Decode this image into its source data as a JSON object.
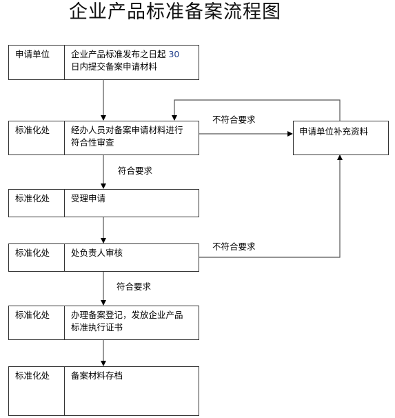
{
  "title": "企业产品标准备案流程图",
  "steps": [
    {
      "dept": "申请单位",
      "desc_line1": "企业产品标准发布之日起 ",
      "desc_num": "30",
      "desc_line2": "日内提交备案申请材料"
    },
    {
      "dept": "标准化处",
      "desc_line1": "经办人员对备案申请材料进行",
      "desc_line2": "符合性审查"
    },
    {
      "dept": "标准化处",
      "desc_line1": "受理申请"
    },
    {
      "dept": "标准化处",
      "desc_line1": "处负责人审核"
    },
    {
      "dept": "标准化处",
      "desc_line1": "办理备案登记，发放企业产品",
      "desc_line2": "标准执行证书"
    },
    {
      "dept": "标准化处",
      "desc_line1": "备案材料存档"
    }
  ],
  "side_box": {
    "desc": "申请单位补充资料"
  },
  "edge_labels": {
    "review_pass": "符合要求",
    "review_fail": "不符合要求",
    "approval_pass": "符合要求",
    "approval_fail": "不符合要求"
  }
}
